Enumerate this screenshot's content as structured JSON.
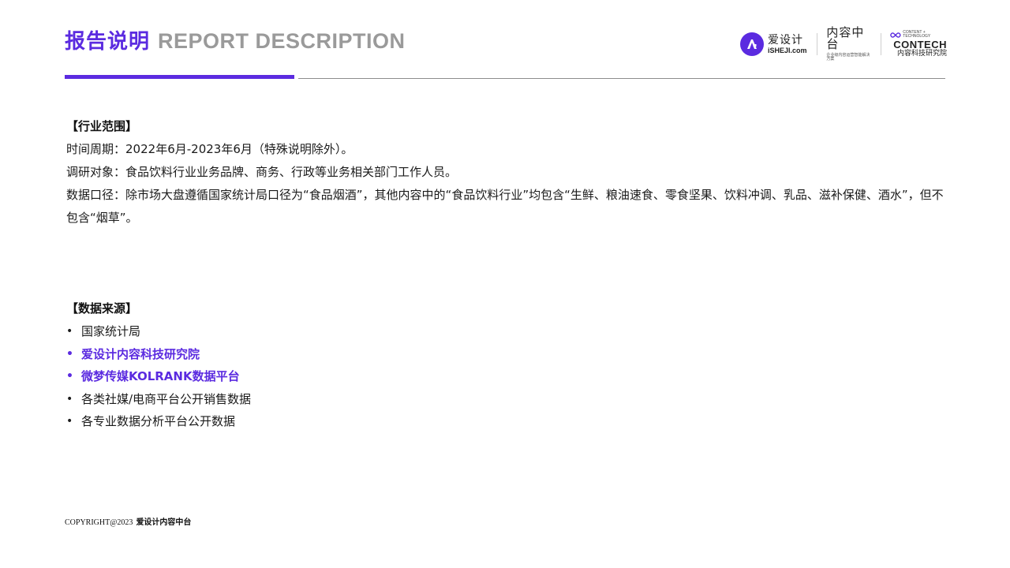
{
  "header": {
    "title_cn": "报告说明",
    "title_en": "REPORT DESCRIPTION",
    "accent_color": "#5b2be0",
    "logos": {
      "ishe_icon": "a-letter-logo-icon",
      "ishe_cn": "爱设计",
      "ishe_en": "iSHEJI.com",
      "neirong_cn": "内容中台",
      "neirong_sub": "企业级内容运营智能解决方案",
      "contech_icon": "infinity-logo-icon",
      "contech_small": "CONTENT + TECHNOLOGY",
      "contech_en": "CONTECH",
      "contech_cn": "内容科技研究院"
    }
  },
  "scope": {
    "title": "【行业范围】",
    "lines": [
      {
        "label": "时间周期：",
        "text": "2022年6月-2023年6月（特殊说明除外）。"
      },
      {
        "label": "调研对象：",
        "text": "食品饮料行业业务品牌、商务、行政等业务相关部门工作人员。"
      },
      {
        "label": "数据口径：",
        "text": "除市场大盘遵循国家统计局口径为“食品烟酒”，其他内容中的“食品饮料行业”均包含“生鲜、粮油速食、零食坚果、饮料冲调、乳品、滋补保健、酒水”，但不包含“烟草”。"
      }
    ]
  },
  "sources": {
    "title": "【数据来源】",
    "bullet": "•",
    "items": [
      {
        "text": "国家统计局",
        "highlight": false
      },
      {
        "text": "爱设计内容科技研究院",
        "highlight": true
      },
      {
        "text": "微梦传媒KOLRANK数据平台",
        "highlight": true
      },
      {
        "text": "各类社媒/电商平台公开销售数据",
        "highlight": false
      },
      {
        "text": "各专业数据分析平台公开数据",
        "highlight": false
      }
    ]
  },
  "footer": {
    "copyright": "COPYRIGHT@2023",
    "company": "爱设计内容中台"
  }
}
